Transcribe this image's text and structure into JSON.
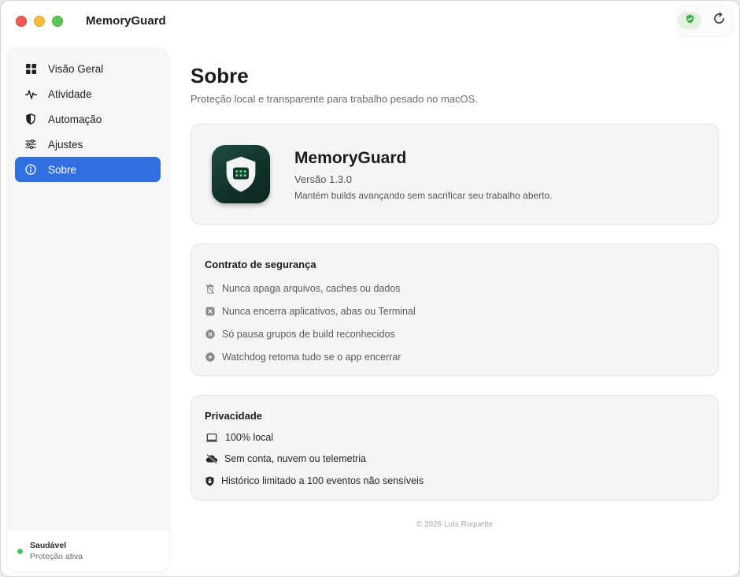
{
  "window": {
    "title": "MemoryGuard"
  },
  "toolbar": {
    "status_icon": "shield-check-icon",
    "refresh_icon": "refresh-icon"
  },
  "sidebar": {
    "items": [
      {
        "label": "Visão Geral",
        "icon": "grid-icon",
        "active": false
      },
      {
        "label": "Atividade",
        "icon": "pulse-icon",
        "active": false
      },
      {
        "label": "Automação",
        "icon": "half-shield-icon",
        "active": false
      },
      {
        "label": "Ajustes",
        "icon": "sliders-icon",
        "active": false
      },
      {
        "label": "Sobre",
        "icon": "info-icon",
        "active": true
      }
    ],
    "status": {
      "title": "Saudável",
      "subtitle": "Proteção ativa",
      "color": "#4bc25a"
    }
  },
  "main": {
    "title": "Sobre",
    "subtitle": "Proteção local e transparente para trabalho pesado no macOS."
  },
  "about": {
    "app_name": "MemoryGuard",
    "version": "Versão 1.3.0",
    "description": "Mantém builds avançando sem sacrificar seu trabalho aberto.",
    "icon": "app-shield-chip-icon"
  },
  "contract": {
    "title": "Contrato de segurança",
    "items": [
      {
        "text": "Nunca apaga arquivos, caches ou dados",
        "icon": "trash-slash-icon"
      },
      {
        "text": "Nunca encerra aplicativos, abas ou Terminal",
        "icon": "x-square-icon"
      },
      {
        "text": "Só pausa grupos de build reconhecidos",
        "icon": "pause-circle-icon"
      },
      {
        "text": "Watchdog retoma tudo se o app encerrar",
        "icon": "play-circle-icon"
      }
    ]
  },
  "privacy": {
    "title": "Privacidade",
    "items": [
      {
        "text": "100% local",
        "icon": "laptop-icon"
      },
      {
        "text": "Sem conta, nuvem ou telemetria",
        "icon": "cloud-slash-icon"
      },
      {
        "text": "Histórico limitado a 100 eventos não sensíveis",
        "icon": "lock-shield-icon"
      }
    ]
  },
  "footer": {
    "copyright": "© 2026 Luís Roquette"
  },
  "colors": {
    "accent": "#2f6fe0",
    "status_green": "#4bc25a",
    "card_bg": "#f5f5f5"
  }
}
